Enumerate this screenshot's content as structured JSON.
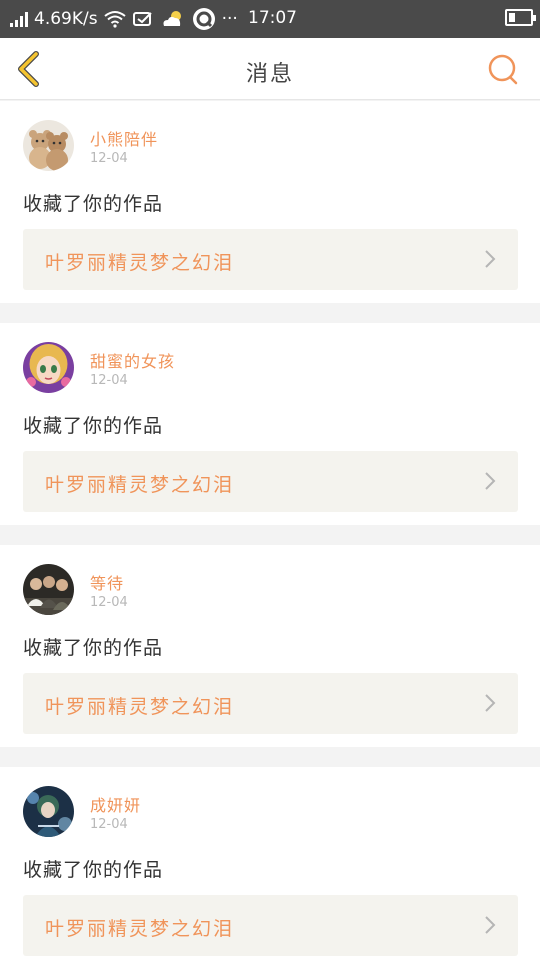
{
  "status_bar": {
    "network_speed": "4.69K/s",
    "time": "17:07",
    "dots": "···"
  },
  "header": {
    "title": "消息",
    "back_icon": "chevron-left-icon",
    "search_icon": "search-icon"
  },
  "colors": {
    "accent": "#f0945a",
    "back_icon": "#f5c430",
    "status_bar": "#4a4a4a",
    "card_link_bg": "#f4f3ee"
  },
  "notifications": [
    {
      "username": "小熊陪伴",
      "date": "12-04",
      "action": "收藏了你的作品",
      "work_title": "叶罗丽精灵梦之幻泪",
      "avatar": "teddy-bears-avatar"
    },
    {
      "username": "甜蜜的女孩",
      "date": "12-04",
      "action": "收藏了你的作品",
      "work_title": "叶罗丽精灵梦之幻泪",
      "avatar": "doll-girl-avatar"
    },
    {
      "username": "等待",
      "date": "12-04",
      "action": "收藏了你的作品",
      "work_title": "叶罗丽精灵梦之幻泪",
      "avatar": "group-photo-avatar"
    },
    {
      "username": "成妍妍",
      "date": "12-04",
      "action": "收藏了你的作品",
      "work_title": "叶罗丽精灵梦之幻泪",
      "avatar": "anime-character-avatar"
    }
  ]
}
